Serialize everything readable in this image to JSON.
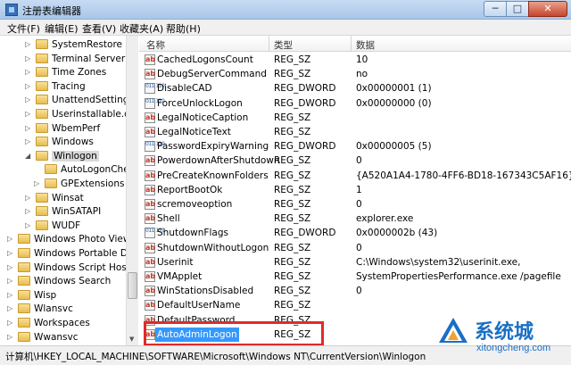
{
  "window": {
    "title": "注册表编辑器",
    "buttons": {
      "minimize": "─",
      "maximize": "□",
      "close": "✕"
    }
  },
  "menu": [
    "文件(F)",
    "编辑(E)",
    "查看(V)",
    "收藏夹(A)",
    "帮助(H)"
  ],
  "tree": {
    "items": [
      {
        "label": "SystemRestore",
        "expander": "▷"
      },
      {
        "label": "Terminal Server",
        "expander": "▷"
      },
      {
        "label": "Time Zones",
        "expander": "▷"
      },
      {
        "label": "Tracing",
        "expander": "▷"
      },
      {
        "label": "UnattendSettings",
        "expander": "▷"
      },
      {
        "label": "Userinstallable.drive",
        "expander": "▷"
      },
      {
        "label": "WbemPerf",
        "expander": "▷"
      },
      {
        "label": "Windows",
        "expander": "▷"
      },
      {
        "label": "Winlogon",
        "expander": "◢",
        "selected": true
      },
      {
        "label": "AutoLogonChecked",
        "expander": ""
      },
      {
        "label": "GPExtensions",
        "expander": "▷"
      },
      {
        "label": "Winsat",
        "expander": "▷"
      },
      {
        "label": "WinSATAPI",
        "expander": "▷"
      },
      {
        "label": "WUDF",
        "expander": "▷"
      },
      {
        "label": "Windows Photo Viewer",
        "expander": "▷"
      },
      {
        "label": "Windows Portable Devices",
        "expander": "▷"
      },
      {
        "label": "Windows Script Host",
        "expander": "▷"
      },
      {
        "label": "Windows Search",
        "expander": "▷"
      },
      {
        "label": "Wisp",
        "expander": "▷"
      },
      {
        "label": "Wlansvc",
        "expander": "▷"
      },
      {
        "label": "Workspaces",
        "expander": "▷"
      },
      {
        "label": "Wwansvc",
        "expander": "▷"
      }
    ]
  },
  "list": {
    "headers": {
      "name": "名称",
      "type": "类型",
      "data": "数据"
    },
    "rows": [
      {
        "icon": "string",
        "name": "CachedLogonsCount",
        "type": "REG_SZ",
        "data": "10"
      },
      {
        "icon": "string",
        "name": "DebugServerCommand",
        "type": "REG_SZ",
        "data": "no"
      },
      {
        "icon": "binary",
        "name": "DisableCAD",
        "type": "REG_DWORD",
        "data": "0x00000001 (1)"
      },
      {
        "icon": "binary",
        "name": "ForceUnlockLogon",
        "type": "REG_DWORD",
        "data": "0x00000000 (0)"
      },
      {
        "icon": "string",
        "name": "LegalNoticeCaption",
        "type": "REG_SZ",
        "data": ""
      },
      {
        "icon": "string",
        "name": "LegalNoticeText",
        "type": "REG_SZ",
        "data": ""
      },
      {
        "icon": "binary",
        "name": "PasswordExpiryWarning",
        "type": "REG_DWORD",
        "data": "0x00000005 (5)"
      },
      {
        "icon": "string",
        "name": "PowerdownAfterShutdown",
        "type": "REG_SZ",
        "data": "0"
      },
      {
        "icon": "string",
        "name": "PreCreateKnownFolders",
        "type": "REG_SZ",
        "data": "{A520A1A4-1780-4FF6-BD18-167343C5AF16}"
      },
      {
        "icon": "string",
        "name": "ReportBootOk",
        "type": "REG_SZ",
        "data": "1"
      },
      {
        "icon": "string",
        "name": "scremoveoption",
        "type": "REG_SZ",
        "data": "0"
      },
      {
        "icon": "string",
        "name": "Shell",
        "type": "REG_SZ",
        "data": "explorer.exe"
      },
      {
        "icon": "binary",
        "name": "ShutdownFlags",
        "type": "REG_DWORD",
        "data": "0x0000002b (43)"
      },
      {
        "icon": "string",
        "name": "ShutdownWithoutLogon",
        "type": "REG_SZ",
        "data": "0"
      },
      {
        "icon": "string",
        "name": "Userinit",
        "type": "REG_SZ",
        "data": "C:\\Windows\\system32\\userinit.exe,"
      },
      {
        "icon": "string",
        "name": "VMApplet",
        "type": "REG_SZ",
        "data": "SystemPropertiesPerformance.exe /pagefile"
      },
      {
        "icon": "string",
        "name": "WinStationsDisabled",
        "type": "REG_SZ",
        "data": "0"
      },
      {
        "icon": "string",
        "name": "DefaultUserName",
        "type": "REG_SZ",
        "data": ""
      },
      {
        "icon": "string",
        "name": "DefaultPassword",
        "type": "REG_SZ",
        "data": ""
      },
      {
        "icon": "string",
        "name": "AutoAdminLogon",
        "type": "REG_SZ",
        "data": "",
        "selected": true
      }
    ]
  },
  "status": {
    "path": "计算机\\HKEY_LOCAL_MACHINE\\SOFTWARE\\Microsoft\\Windows NT\\CurrentVersion\\Winlogon"
  },
  "watermark": {
    "name": "系统城",
    "url": "xitongcheng.com"
  },
  "colors": {
    "selection": "#3399ff",
    "highlight_box": "#e02a2a",
    "watermark": "#1a6fc4"
  }
}
